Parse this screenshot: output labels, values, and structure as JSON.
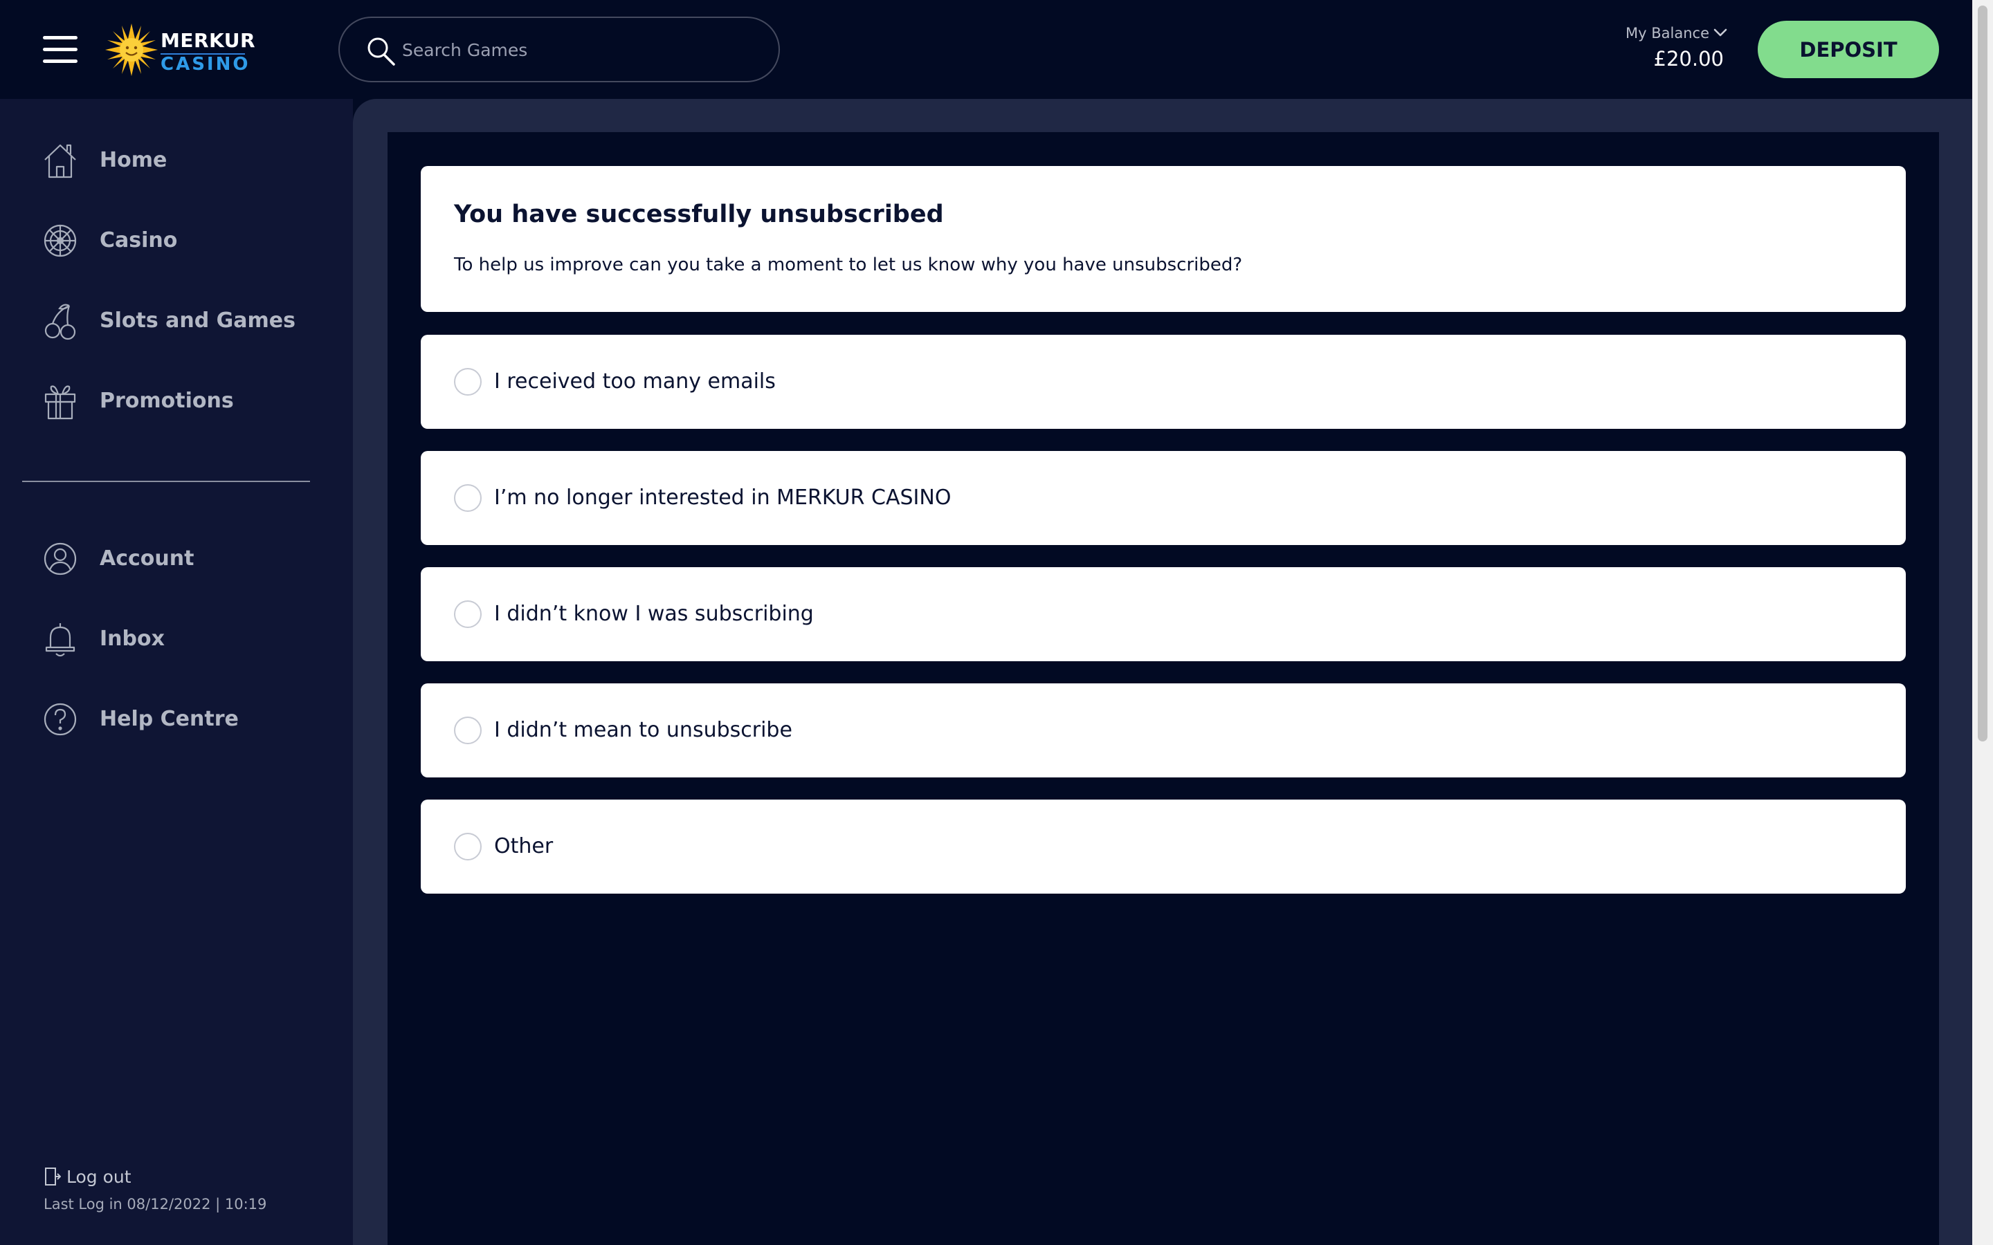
{
  "header": {
    "logo_line1": "MERKUR",
    "logo_line2": "CASINO",
    "search_placeholder": "Search Games",
    "balance_label": "My Balance",
    "balance_value": "£20.00",
    "deposit_label": "DEPOSIT"
  },
  "sidebar": {
    "items": [
      {
        "label": "Home",
        "icon": "home-icon"
      },
      {
        "label": "Casino",
        "icon": "roulette-icon"
      },
      {
        "label": "Slots and Games",
        "icon": "cherries-icon"
      },
      {
        "label": "Promotions",
        "icon": "gift-icon"
      }
    ],
    "account_items": [
      {
        "label": "Account",
        "icon": "user-icon"
      },
      {
        "label": "Inbox",
        "icon": "bell-icon"
      },
      {
        "label": "Help Centre",
        "icon": "question-icon"
      }
    ],
    "logout_label": "Log out",
    "last_login": "Last Log in 08/12/2022 | 10:19"
  },
  "main": {
    "title": "You have successfully unsubscribed",
    "subtitle": "To help us improve can you take a moment to let us know why you have unsubscribed?",
    "options": [
      {
        "label": "I received too many emails"
      },
      {
        "label": "I’m no longer interested in MERKUR CASINO"
      },
      {
        "label": "I didn’t know I was subscribing"
      },
      {
        "label": "I didn’t mean to unsubscribe"
      },
      {
        "label": "Other"
      }
    ]
  },
  "colors": {
    "background": "#020a23",
    "sidebar": "#0f1534",
    "panel": "#202845",
    "deposit_button": "#82dc8d",
    "brand_blue": "#2f9be8"
  }
}
